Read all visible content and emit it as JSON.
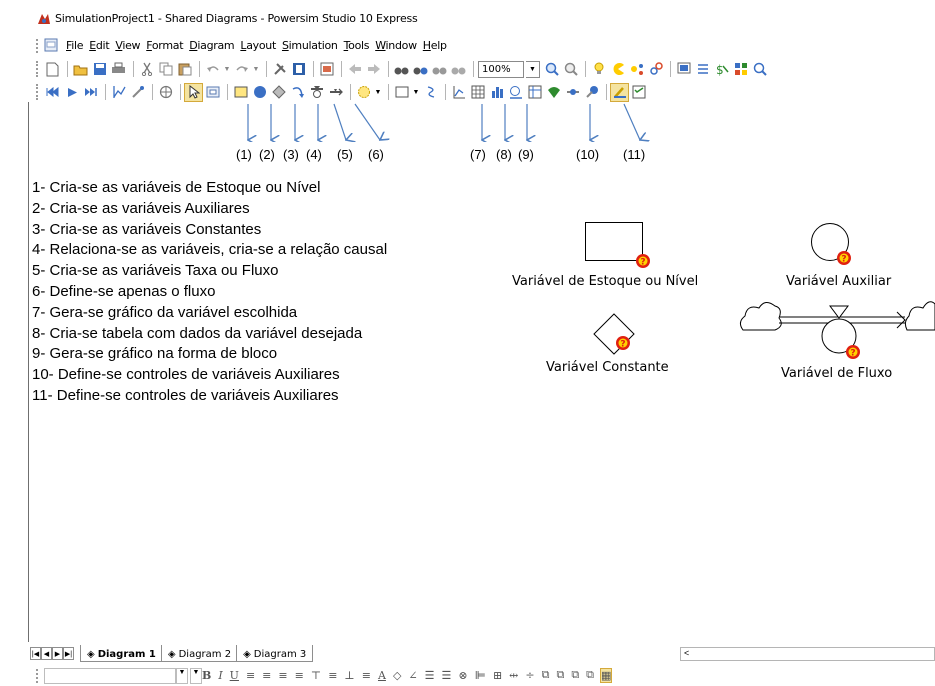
{
  "window": {
    "title": "SimulationProject1 - Shared Diagrams - Powersim Studio 10 Express"
  },
  "menu": [
    "File",
    "Edit",
    "View",
    "Format",
    "Diagram",
    "Layout",
    "Simulation",
    "Tools",
    "Window",
    "Help"
  ],
  "toolbar": {
    "zoom_value": "100%"
  },
  "callouts": [
    "(1)",
    "(2)",
    "(3)",
    "(4)",
    "(5)",
    "(6)",
    "(7)",
    "(8)",
    "(9)",
    "(10)",
    "(11)"
  ],
  "descriptions": [
    "1- Cria-se as variáveis de Estoque ou Nível",
    "2- Cria-se as variáveis Auxiliares",
    "3- Cria-se as variáveis  Constantes",
    "4- Relaciona-se as variáveis, cria-se a relação causal",
    "5- Cria-se as variáveis Taxa  ou  Fluxo",
    "6- Define-se apenas o fluxo",
    "7- Gera-se gráfico da variável escolhida",
    "8- Cria-se tabela com dados da variável desejada",
    "9- Gera-se gráfico na forma de bloco",
    "10- Define-se controles de variáveis Auxiliares",
    "11- Define-se controles de variáveis Auxiliares"
  ],
  "legend": {
    "stock": "Variável de Estoque ou Nível",
    "auxiliary": "Variável Auxiliar",
    "constant": "Variável Constante",
    "flow": "Variável de Fluxo",
    "warning_mark": "?"
  },
  "tabs": [
    "Diagram 1",
    "Diagram 2",
    "Diagram 3"
  ],
  "format_bar": {
    "bold": "B",
    "italic": "I",
    "underline": "U",
    "font_color": "A"
  },
  "colors": {
    "arrow_blue": "#4f7fc0",
    "warning_red": "#e02010",
    "warning_yellow": "#ffd200",
    "select_highlight": "#f4e3a0"
  }
}
